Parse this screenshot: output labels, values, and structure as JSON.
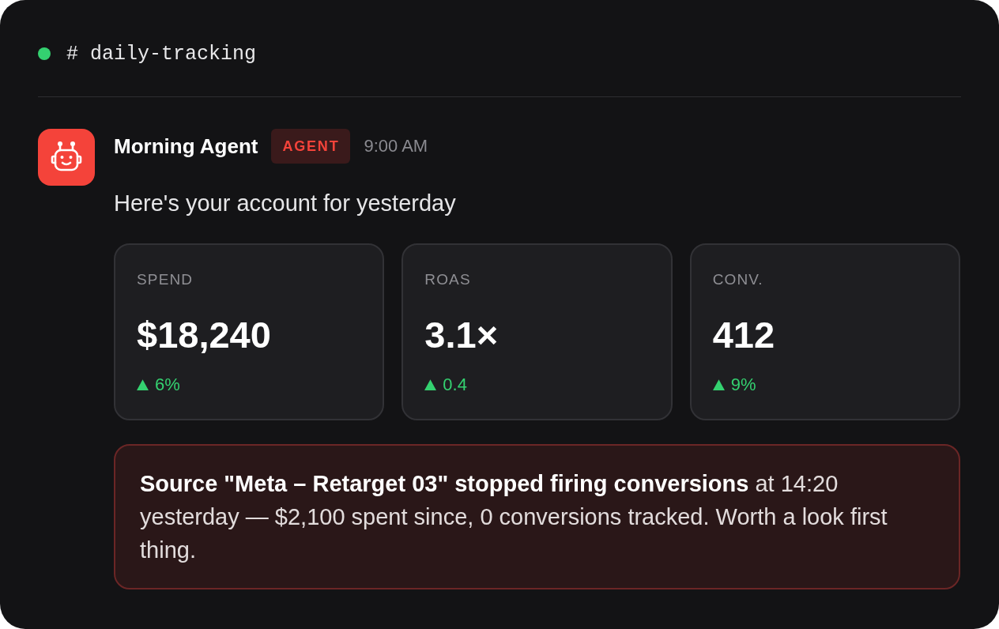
{
  "channel": {
    "name": "# daily-tracking",
    "online": true
  },
  "message": {
    "author": "Morning Agent",
    "badge": "AGENT",
    "time": "9:00 AM",
    "text": "Here's your account for yesterday",
    "metrics": [
      {
        "label": "SPEND",
        "value": "$18,240",
        "delta": "6%",
        "kind": "increase"
      },
      {
        "label": "ROAS",
        "value": "3.1×",
        "delta": "0.4",
        "kind": "increase"
      },
      {
        "label": "CONV.",
        "value": "412",
        "delta": "9%",
        "kind": "increase"
      }
    ],
    "alert": {
      "text": "**Source \"Meta – Retarget 03\" stopped firing conversions** at 14:20 yesterday — $2,100 spent since, 0 conversions tracked. Worth a look first thing."
    }
  }
}
